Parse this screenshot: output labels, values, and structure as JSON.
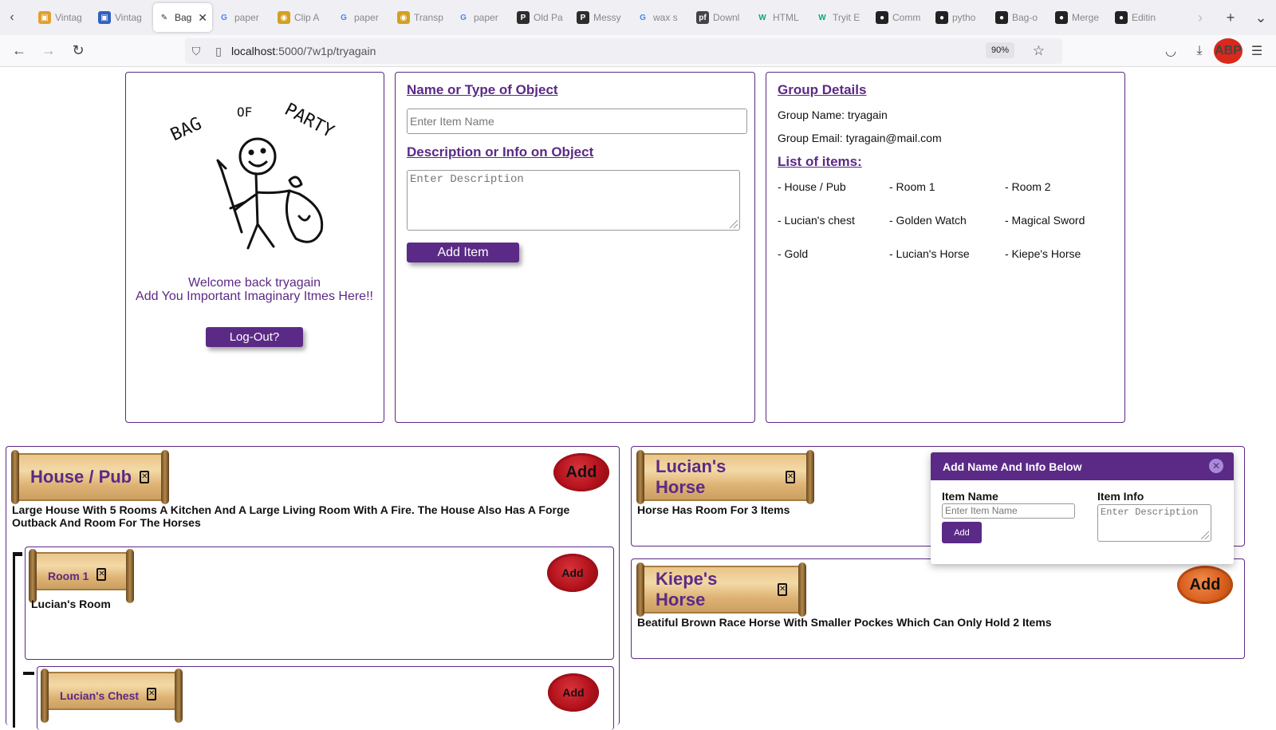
{
  "browser": {
    "tabs": [
      {
        "title": "Vintag",
        "icon": "bag-icon",
        "color": "#e0a030"
      },
      {
        "title": "Vintag",
        "icon": "bag-icon",
        "color": "#3060c0"
      },
      {
        "title": "Bag",
        "icon": "sketch-icon",
        "color": "#ffffff",
        "active": true
      },
      {
        "title": "paper",
        "icon": "google-icon",
        "color": "#4285f4"
      },
      {
        "title": "Clip A",
        "icon": "clipart-icon",
        "color": "#d4a020"
      },
      {
        "title": "paper",
        "icon": "google-icon",
        "color": "#4285f4"
      },
      {
        "title": "Transp",
        "icon": "clipart-icon",
        "color": "#d4a020"
      },
      {
        "title": "paper",
        "icon": "google-icon",
        "color": "#4285f4"
      },
      {
        "title": "Old Pa",
        "icon": "p-icon",
        "color": "#2d2d2d"
      },
      {
        "title": "Messy",
        "icon": "p-icon",
        "color": "#2d2d2d"
      },
      {
        "title": "wax s",
        "icon": "google-icon",
        "color": "#4285f4"
      },
      {
        "title": "Downl",
        "icon": "pf-icon",
        "color": "#444444"
      },
      {
        "title": "HTML",
        "icon": "w3-icon",
        "color": "#04aa6d"
      },
      {
        "title": "Tryit E",
        "icon": "w3-icon",
        "color": "#04aa6d"
      },
      {
        "title": "Comm",
        "icon": "github-icon",
        "color": "#222222"
      },
      {
        "title": "pytho",
        "icon": "github-icon",
        "color": "#222222"
      },
      {
        "title": "Bag-o",
        "icon": "github-icon",
        "color": "#222222"
      },
      {
        "title": "Merge",
        "icon": "github-icon",
        "color": "#222222"
      },
      {
        "title": "Editin",
        "icon": "github-icon",
        "color": "#222222"
      }
    ],
    "url_host": "localhost",
    "url_path": ":5000/7w1p/tryagain",
    "zoom": "90%",
    "abp_label": "ABP"
  },
  "welcome": {
    "logo_words": [
      "BAG",
      "OF",
      "PARTY"
    ],
    "line1": "Welcome back tryagain",
    "line2": "Add You Important Imaginary Itmes Here!!",
    "logout_label": "Log-Out?"
  },
  "add_form": {
    "name_heading": "Name or Type of Object",
    "name_placeholder": "Enter Item Name",
    "desc_heading": "Description or Info on Object",
    "desc_placeholder": "Enter Description",
    "add_label": "Add Item"
  },
  "group": {
    "heading": "Group Details",
    "name_line": "Group Name: tryagain",
    "email_line": "Group Email: tyragain@mail.com",
    "list_heading": "List of items:",
    "items": [
      "- House / Pub",
      "- Room 1",
      "- Room 2",
      "- Lucian's chest",
      "- Golden Watch",
      "- Magical Sword",
      "- Gold",
      "- Lucian's Horse",
      "- Kiepe's Horse"
    ]
  },
  "cards": {
    "house": {
      "title": "House / Pub",
      "add_label": "Add",
      "description": "Large House With 5 Rooms A Kitchen And A Large Living Room With A Fire. The House Also Has A Forge Outback And Room For The Horses"
    },
    "room1": {
      "title": "Room 1",
      "add_label": "Add",
      "description": "Lucian's Room"
    },
    "chest": {
      "title": "Lucian's Chest",
      "add_label": "Add"
    },
    "lucian_horse": {
      "title": "Lucian's Horse",
      "description": "Horse Has Room For 3 Items"
    },
    "kiepe_horse": {
      "title": "Kiepe's Horse",
      "add_label": "Add",
      "description": "Beatiful Brown Race Horse With Smaller Pockes Which Can Only Hold 2 Items"
    }
  },
  "popup": {
    "title": "Add Name And Info Below",
    "item_name_label": "Item Name",
    "item_name_placeholder": "Enter Item Name",
    "item_info_label": "Item Info",
    "item_info_placeholder": "Enter Description",
    "add_label": "Add",
    "close_icon": "close-icon"
  },
  "colors": {
    "accent": "#5b2a86",
    "seal_red": "#b3121c",
    "seal_orange": "#d9601e",
    "parchment": "#e9c58b"
  }
}
